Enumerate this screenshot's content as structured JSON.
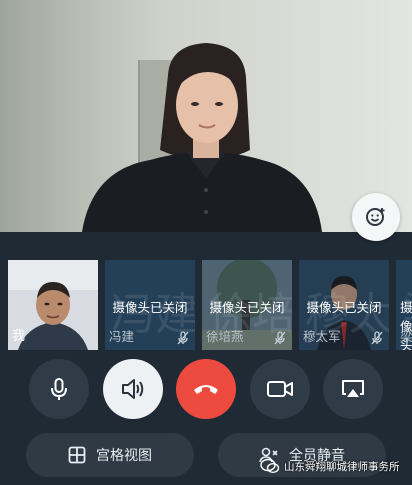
{
  "call": {
    "self_label": "我",
    "camera_off_text": "摄像头已关闭"
  },
  "participants": [
    {
      "name": "冯建",
      "bg_name": "冯建",
      "camera_off": true
    },
    {
      "name": "徐培燕",
      "bg_name": "徐培燕",
      "camera_off": true
    },
    {
      "name": "穆太军",
      "bg_name": "穆太军",
      "camera_off": true
    },
    {
      "name": "梁",
      "bg_name": "梁",
      "camera_off": true
    }
  ],
  "controls": {
    "grid_view_label": "宫格视图",
    "mute_all_label": "全员静音"
  },
  "watermark": {
    "text": "山东舜翔聊城律师事务所"
  },
  "colors": {
    "panel_bg": "#1f2a35",
    "hangup": "#ee4b40",
    "tile_bg": "#244058"
  }
}
